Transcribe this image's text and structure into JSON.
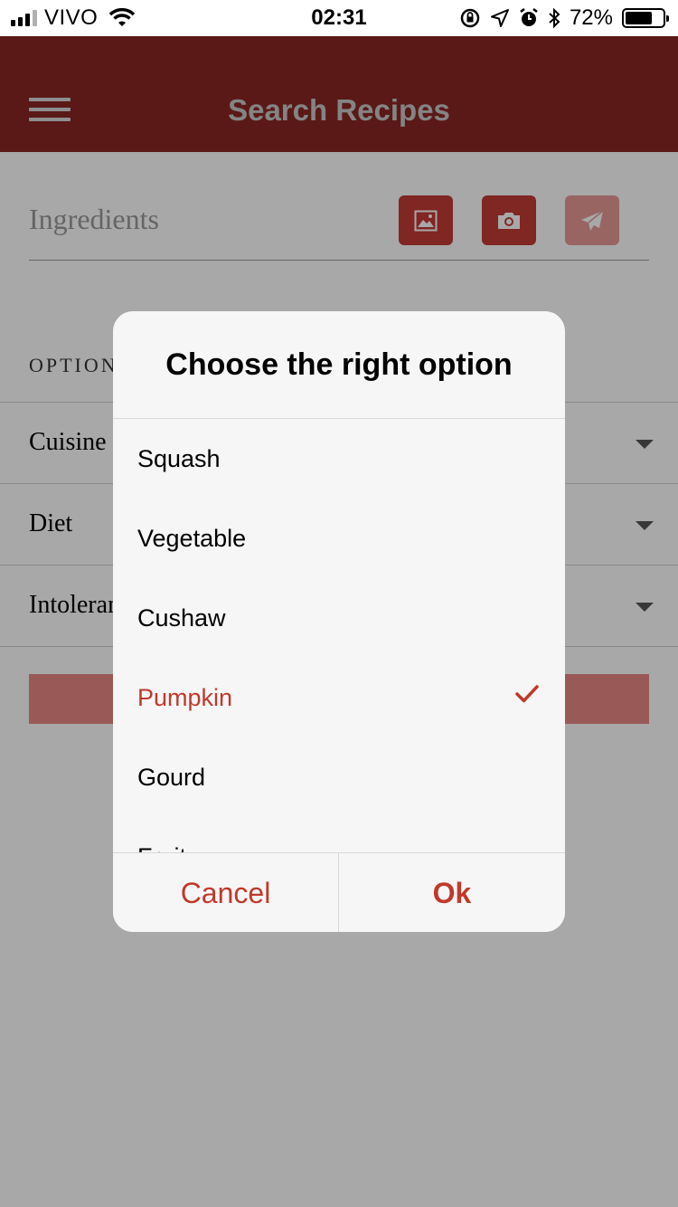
{
  "status_bar": {
    "carrier": "VIVO",
    "time": "02:31",
    "battery": "72%",
    "battery_level": 0.72,
    "icons": [
      "signal-icon",
      "wifi-icon",
      "orientation-lock-icon",
      "location-icon",
      "alarm-icon",
      "bluetooth-icon",
      "battery-icon"
    ]
  },
  "app_bar": {
    "title": "Search Recipes",
    "menu_icon": "hamburger-menu-icon",
    "background": "#892723"
  },
  "search": {
    "placeholder": "Ingredients",
    "buttons": [
      {
        "name": "gallery-button",
        "icon": "image-icon"
      },
      {
        "name": "camera-button",
        "icon": "camera-icon"
      },
      {
        "name": "send-button",
        "icon": "paper-plane-icon"
      }
    ]
  },
  "options": {
    "heading": "OPTION",
    "rows": [
      {
        "label": "Cuisine"
      },
      {
        "label": "Diet"
      },
      {
        "label": "Intoleran"
      }
    ]
  },
  "dialog": {
    "title": "Choose the right option",
    "items": [
      {
        "label": "Squash",
        "selected": false
      },
      {
        "label": "Vegetable",
        "selected": false
      },
      {
        "label": "Cushaw",
        "selected": false
      },
      {
        "label": "Pumpkin",
        "selected": true
      },
      {
        "label": "Gourd",
        "selected": false
      },
      {
        "label": "Fruit",
        "selected": false
      }
    ],
    "cancel_label": "Cancel",
    "ok_label": "Ok",
    "accent": "#c0392b"
  }
}
